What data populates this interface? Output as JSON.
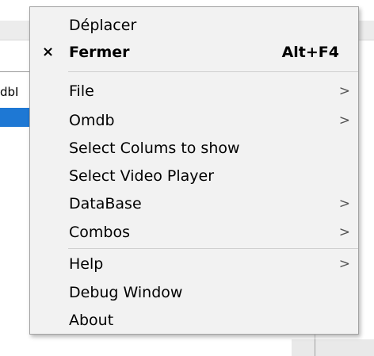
{
  "background": {
    "left_text": "dbI"
  },
  "menu": {
    "items": [
      {
        "label": "Déplacer"
      },
      {
        "label": "Fermer",
        "check": "×",
        "shortcut": "Alt+F4"
      },
      {
        "label": "File",
        "arrow": ">"
      },
      {
        "label": "Omdb",
        "arrow": ">"
      },
      {
        "label": "Select Colums to show"
      },
      {
        "label": "Select Video Player"
      },
      {
        "label": "DataBase",
        "arrow": ">"
      },
      {
        "label": "Combos",
        "arrow": ">"
      },
      {
        "label": "Help",
        "arrow": ">"
      },
      {
        "label": "Debug Window"
      },
      {
        "label": "About"
      }
    ]
  },
  "colors": {
    "menu_background": "#f2f2f2",
    "selection_blue": "#1e78d4"
  },
  "icons": {
    "check": "close-x-icon",
    "submenu": "chevron-right-icon"
  }
}
